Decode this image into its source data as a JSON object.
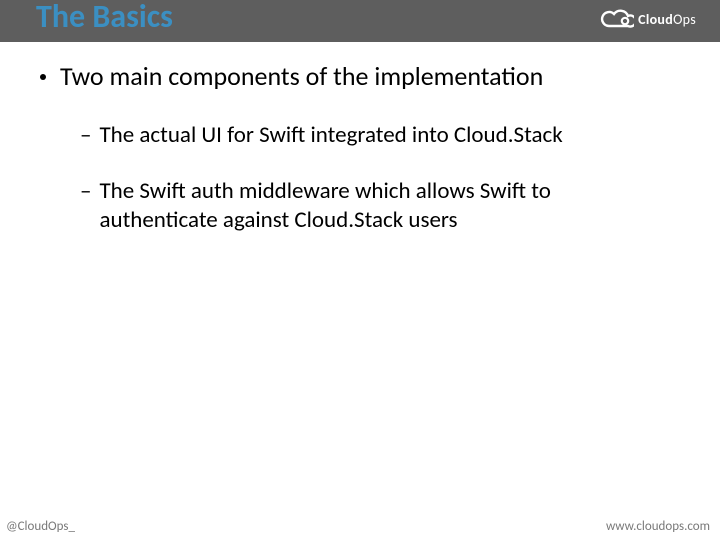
{
  "header": {
    "title": "The Basics",
    "brand_bold": "Cloud",
    "brand_thin": "Ops"
  },
  "content": {
    "main_bullet": "Two main components of the implementation",
    "sub_bullets": [
      "The actual UI for Swift integrated into Cloud.Stack",
      "The Swift auth middleware which allows Swift to authenticate against Cloud.Stack users"
    ]
  },
  "footer": {
    "left": "@CloudOps_",
    "right": "www.cloudops.com"
  }
}
